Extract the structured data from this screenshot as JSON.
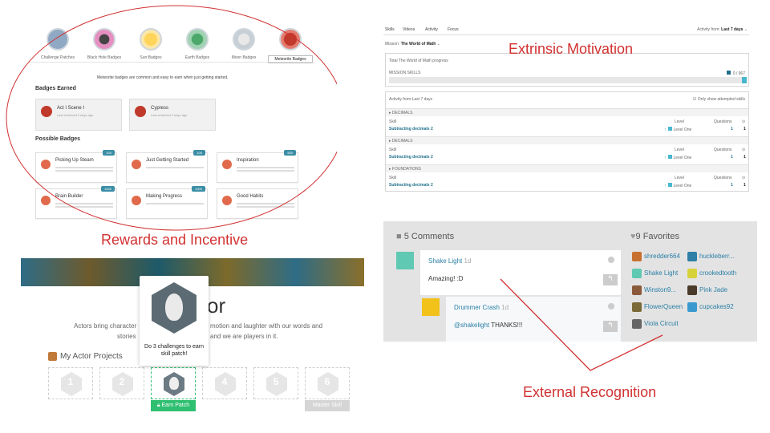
{
  "annotations": {
    "extrinsic": "Extrinsic Motivation",
    "rewards": "Rewards and Incentive",
    "recognition": "External Recognition"
  },
  "colors": {
    "annotation": "#d13131",
    "link": "#1f6f8b",
    "accent_green": "#2fbf71",
    "points_badge": "#3b8ea5"
  },
  "badges": {
    "top": [
      {
        "label": "Challenge Patches",
        "icon": "challenge-patch-icon"
      },
      {
        "label": "Black Hole Badges",
        "icon": "black-hole-icon"
      },
      {
        "label": "Sun Badges",
        "icon": "sun-icon"
      },
      {
        "label": "Earth Badges",
        "icon": "earth-icon"
      },
      {
        "label": "Moon Badges",
        "icon": "moon-icon"
      },
      {
        "label": "Meteorite Badges",
        "icon": "meteorite-icon"
      }
    ],
    "note": "Meteorite badges are common and easy to earn when just getting started.",
    "earned_heading": "Badges Earned",
    "earned": [
      {
        "title": "Act I Scene I",
        "sub": "Last achieved 2 days ago"
      },
      {
        "title": "Cypress",
        "sub": "Last achieved 2 days ago"
      }
    ],
    "possible_heading": "Possible Badges",
    "possible": [
      {
        "title": "Picking Up Steam",
        "points": "100"
      },
      {
        "title": "Just Getting Started",
        "points": "100"
      },
      {
        "title": "Inspiration",
        "points": "500"
      },
      {
        "title": "Brain Builder",
        "points": "1000"
      },
      {
        "title": "Making Progress",
        "points": "1000"
      },
      {
        "title": "Good Habits",
        "points": ""
      }
    ]
  },
  "skills": {
    "tabs": [
      "Skills",
      "Videos",
      "Activity",
      "Focus"
    ],
    "activity_from_label": "Activity from:",
    "activity_from_value": "Last 7 days",
    "mission_label": "Mission:",
    "mission_value": "The World of Math",
    "progress_title": "Total The World of Math progress",
    "mission_skills_label": "MISSION SKILLS",
    "mission_skills_value": "0 / 967",
    "activity_header": "Activity from:Last 7 days",
    "only_attempted": "Only show attempted skills",
    "col_skill": "Skill",
    "col_level": "Level",
    "col_questions": "Questions",
    "groups": [
      {
        "name": "DECIMALS",
        "skill": "Subtracting decimals 2",
        "level": "Level One",
        "q1": "1",
        "q2": "1"
      },
      {
        "name": "DECIMALS",
        "skill": "Subtracting decimals 2",
        "level": "Level One",
        "q1": "1",
        "q2": "1"
      },
      {
        "name": "FOUNDATIONS",
        "skill": "Subtracting decimals 2",
        "level": "Level One",
        "q1": "1",
        "q2": "1"
      }
    ]
  },
  "actor": {
    "title_fragment": "or",
    "desc_line1": "Actors bring character",
    "desc_line1b": "motion and laughter with our words and",
    "desc_line2": "stories",
    "desc_line2b": "and we are players in it.",
    "projects_title": "My Actor Projects",
    "tooltip": "Do 3 challenges to earn skill patch!",
    "slots": [
      "1",
      "2",
      "3",
      "4",
      "5",
      "6"
    ],
    "earn_patch": "Earn Patch",
    "master_skill": "Master Skill"
  },
  "comments": {
    "count_label": "5 Comments",
    "favorites_label": "9 Favorites",
    "items": [
      {
        "author": "Shake Light",
        "time": "1d",
        "text": "Amazing! :D"
      },
      {
        "author": "Drummer Crash",
        "time": "1d",
        "mention": "@shakelight",
        "text": "THANKS!!!"
      }
    ],
    "favorites": [
      "shredder664",
      "huckleberr...",
      "Shake Light",
      "crookedtooth",
      "Winston9...",
      "Pink Jade",
      "FlowerQueen",
      "cupcakes92",
      "Viola Circuit"
    ]
  }
}
